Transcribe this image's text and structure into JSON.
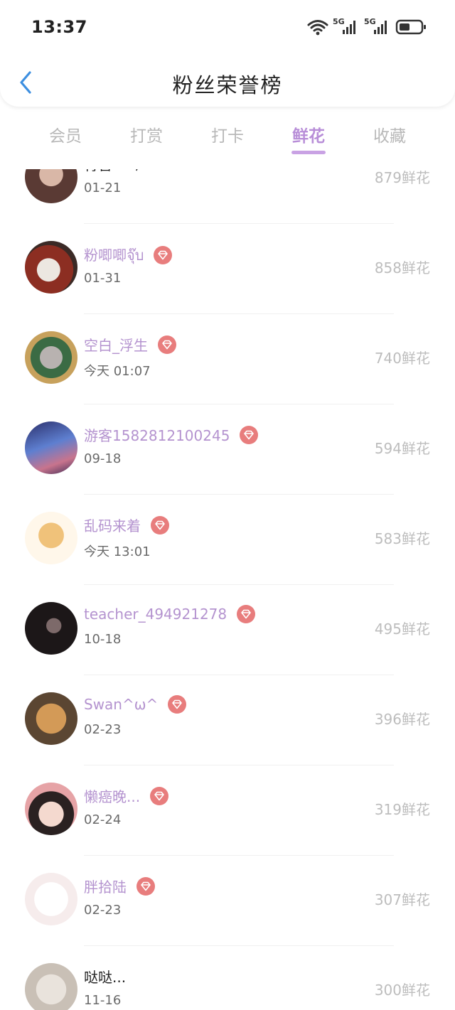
{
  "status": {
    "time": "13:37",
    "sim1": "5G",
    "sim2": "5G"
  },
  "header": {
    "title": "粉丝荣誉榜"
  },
  "tabs": [
    {
      "label": "会员"
    },
    {
      "label": "打赏"
    },
    {
      "label": "打卡"
    },
    {
      "label": "鲜花"
    },
    {
      "label": "收藏"
    }
  ],
  "active_tab": "鲜花",
  "rows": [
    {
      "name": "青害︶ㄣ",
      "date": "01-21",
      "count": "879鲜花",
      "badge": false,
      "plain": true
    },
    {
      "name": "粉唧唧จุ๊บ",
      "date": "01-31",
      "count": "858鲜花",
      "badge": true
    },
    {
      "name": "空白_浮生",
      "date": "今天 01:07",
      "count": "740鲜花",
      "badge": true
    },
    {
      "name": "游客1582812100245",
      "date": "09-18",
      "count": "594鲜花",
      "badge": true
    },
    {
      "name": "乱码来着",
      "date": "今天 13:01",
      "count": "583鲜花",
      "badge": true
    },
    {
      "name": "teacher_494921278",
      "date": "10-18",
      "count": "495鲜花",
      "badge": true
    },
    {
      "name": "  Swan^ω^",
      "date": "02-23",
      "count": "396鲜花",
      "badge": true
    },
    {
      "name": "懒癌晚...",
      "date": "02-24",
      "count": "319鲜花",
      "badge": true
    },
    {
      "name": "胖拾陆",
      "date": "02-23",
      "count": "307鲜花",
      "badge": true
    },
    {
      "name": "哒哒...",
      "date": "11-16",
      "count": "300鲜花",
      "badge": false,
      "plain": true
    }
  ],
  "colors": {
    "accent": "#b88ed8",
    "badge": "#e87d7d",
    "count": "#bdbdbd"
  }
}
